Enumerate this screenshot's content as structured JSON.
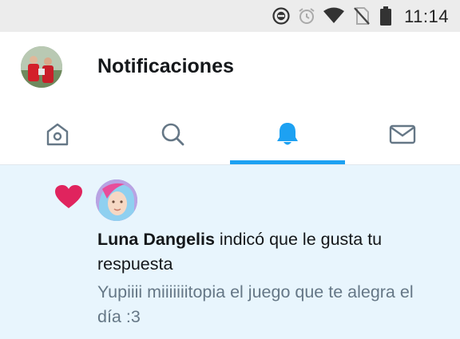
{
  "status_bar": {
    "time": "11:14",
    "icons": [
      "do-not-disturb-icon",
      "alarm-icon",
      "wifi-icon",
      "no-sim-icon",
      "battery-icon"
    ]
  },
  "header": {
    "title": "Notificaciones",
    "avatar": "profile-avatar"
  },
  "tabs": [
    {
      "name": "home",
      "icon": "home-icon",
      "has_new": true
    },
    {
      "name": "search",
      "icon": "search-icon"
    },
    {
      "name": "notifications",
      "icon": "bell-icon",
      "active": true
    },
    {
      "name": "messages",
      "icon": "mail-icon"
    }
  ],
  "notification": {
    "icon": "heart-icon",
    "username": "Luna Dangelis",
    "action_text": " indicó que le gusta tu respuesta",
    "preview": "Yupiiii miiiiiiitopia el juego que te alegra el día :3"
  },
  "colors": {
    "accent": "#1da1f2",
    "heart": "#e0245e",
    "highlight_bg": "#e8f5fd",
    "secondary_text": "#657786"
  }
}
